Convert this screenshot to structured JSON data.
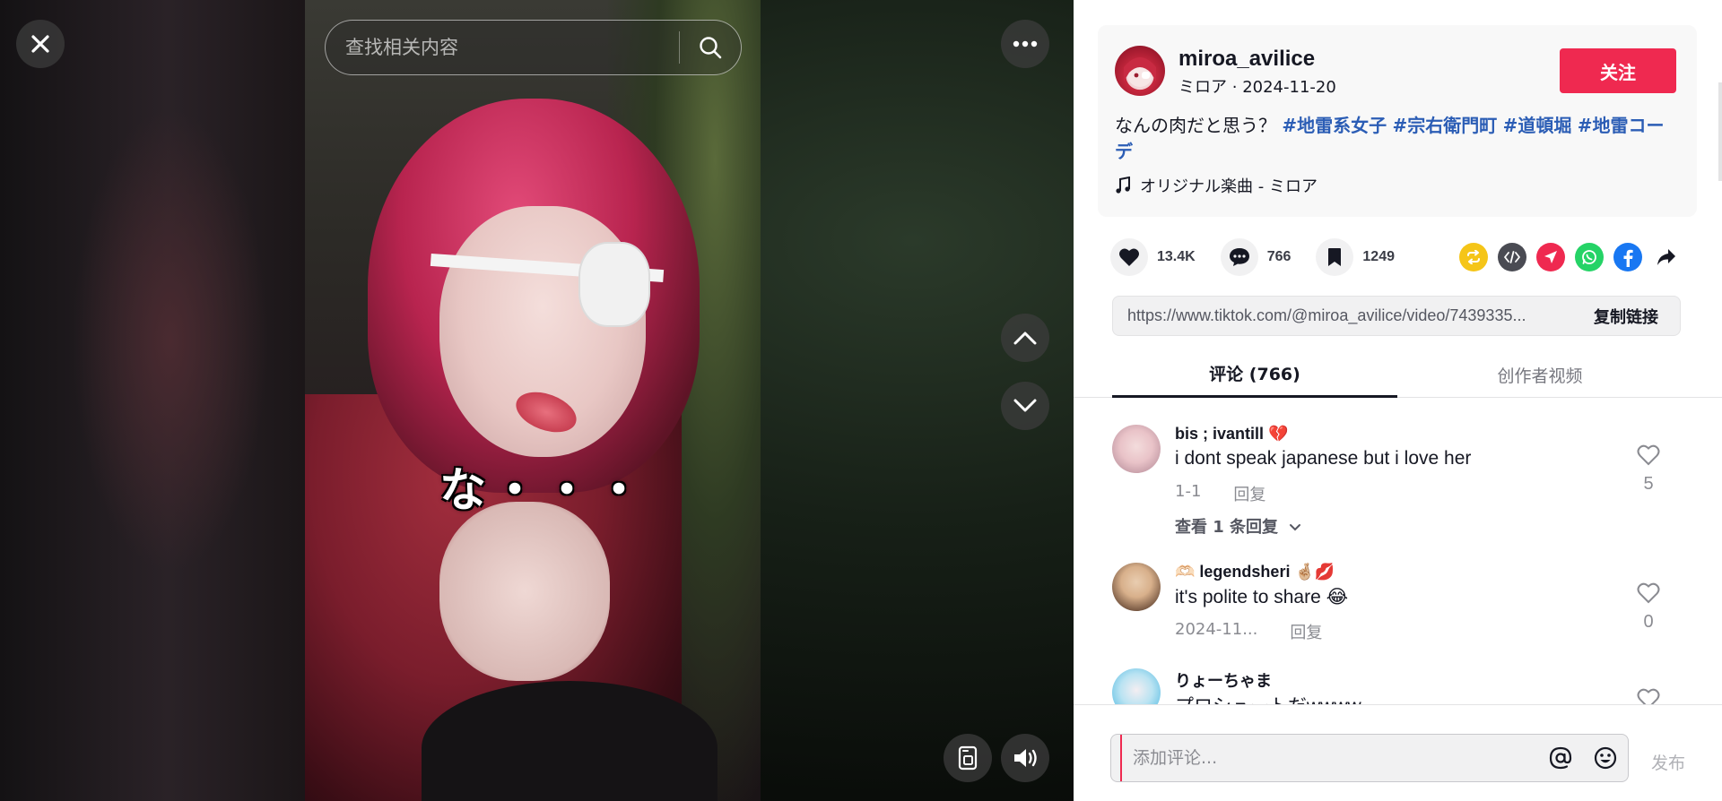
{
  "search": {
    "placeholder": "查找相关内容"
  },
  "video": {
    "caption": "な・・・"
  },
  "author": {
    "username": "miroa_avilice",
    "display_name": "ミロア",
    "date": "2024-11-20",
    "follow_label": "关注"
  },
  "description": {
    "text": "なんの肉だと思う？",
    "hashtags": [
      "#地雷系女子",
      "#宗右衛門町",
      "#道頓堀",
      "#地雷コーデ"
    ]
  },
  "music": {
    "label": "オリジナル楽曲 - ミロア"
  },
  "stats": {
    "likes": "13.4K",
    "comments": "766",
    "saves": "1249"
  },
  "share": {
    "icons": [
      "repost-icon",
      "embed-icon",
      "send-icon",
      "whatsapp-icon",
      "facebook-icon",
      "share-arrow-icon"
    ],
    "colors": {
      "repost": "#f5c518",
      "embed": "#4a4b53",
      "send": "#ef2950",
      "whatsapp": "#25d366",
      "facebook": "#1877f2"
    }
  },
  "link": {
    "url": "https://www.tiktok.com/@miroa_avilice/video/7439335...",
    "copy_label": "复制链接"
  },
  "tabs": [
    {
      "label": "评论 (766)"
    },
    {
      "label": "创作者视频"
    }
  ],
  "comments": [
    {
      "name": "bis ; ivantill 💔",
      "text": "i dont speak japanese but i love her",
      "date": "1-1",
      "reply": "回复",
      "likes": "5",
      "view_replies": "查看 1 条回复"
    },
    {
      "name": "🫶🏻 legendsheri 🤞🏼💋",
      "text": "it's polite to share 😂",
      "date": "2024-11...",
      "reply": "回复",
      "likes": "0"
    },
    {
      "name": "りょーちゃま",
      "text": "プロシュートだwwww"
    }
  ],
  "comment_box": {
    "placeholder": "添加评论...",
    "post_label": "发布"
  },
  "colors": {
    "brand": "#ef2950",
    "hashtag": "#2b5db5"
  }
}
